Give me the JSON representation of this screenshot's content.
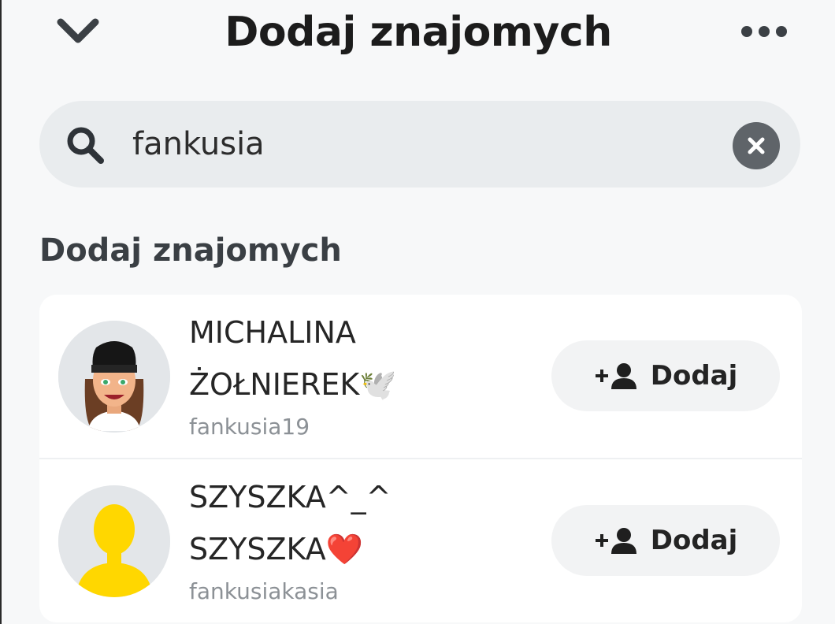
{
  "header": {
    "title": "Dodaj znajomych",
    "back_icon": "chevron-down-icon",
    "more_icon": "more-dots-icon"
  },
  "search": {
    "value": "fankusia",
    "search_icon": "search-icon",
    "clear_icon": "clear-icon"
  },
  "section": {
    "title": "Dodaj znajomych"
  },
  "results": [
    {
      "name_line1": "MICHALINA",
      "name_line2": "ŻOŁNIEREK🕊️",
      "username": "fankusia19",
      "avatar": "bitmoji-avatar",
      "add_label": "Dodaj",
      "add_icon": "add-friend-icon"
    },
    {
      "name_line1": "SZYSZKA^_^",
      "name_line2": "SZYSZKA❤️",
      "username": "fankusiakasia",
      "avatar": "default-avatar",
      "add_label": "Dodaj",
      "add_icon": "add-friend-icon"
    }
  ],
  "colors": {
    "background": "#f7f8f9",
    "search_bg": "#e9ecee",
    "card_bg": "#ffffff",
    "default_avatar": "#ffd700"
  }
}
